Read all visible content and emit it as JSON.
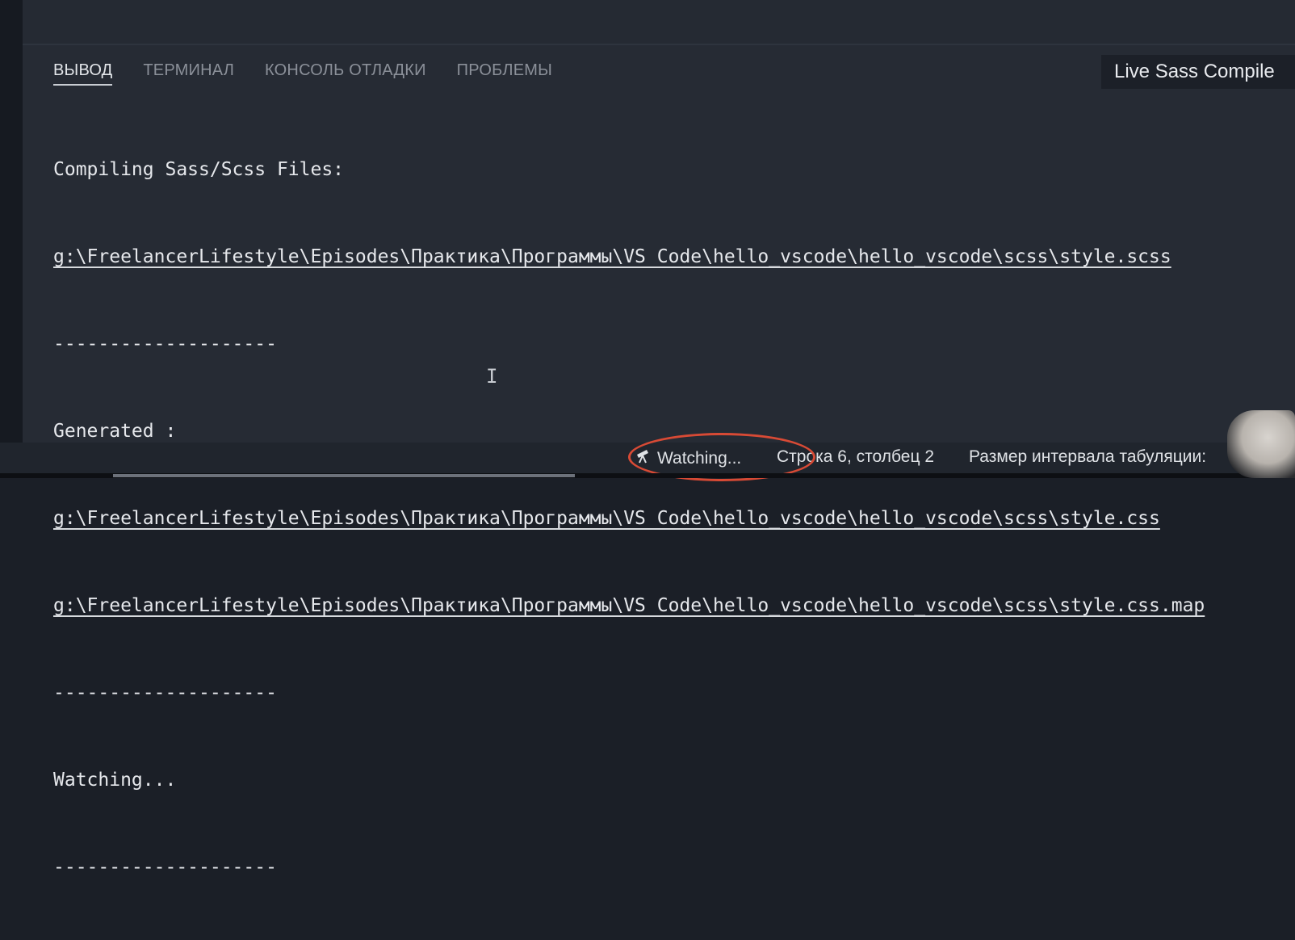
{
  "tabs": [
    "ВЫВОД",
    "ТЕРМИНАЛ",
    "КОНСОЛЬ ОТЛАДКИ",
    "ПРОБЛЕМЫ"
  ],
  "dropdown": "Live Sass Compile",
  "output": {
    "l1": "Compiling Sass/Scss Files:",
    "l2": "g:\\FreelancerLifestyle\\Episodes\\Практика\\Программы\\VS Code\\hello_vscode\\hello_vscode\\scss\\style.scss",
    "l3": "--------------------",
    "l4": "Generated :",
    "l5": "g:\\FreelancerLifestyle\\Episodes\\Практика\\Программы\\VS Code\\hello_vscode\\hello_vscode\\scss\\style.css",
    "l6": "g:\\FreelancerLifestyle\\Episodes\\Практика\\Программы\\VS Code\\hello_vscode\\hello_vscode\\scss\\style.css.map",
    "l7": "--------------------",
    "l8": "Watching...",
    "l9": "--------------------"
  },
  "cursor_glyph": "I",
  "status": {
    "watching_icon": "telescope-icon",
    "watching": "Watching...",
    "position": "Строка 6, столбец 2",
    "tab_size": "Размер интервала табуляции:"
  },
  "colors": {
    "panel_bg": "#262b34",
    "highlight_circle": "#d84a35"
  }
}
